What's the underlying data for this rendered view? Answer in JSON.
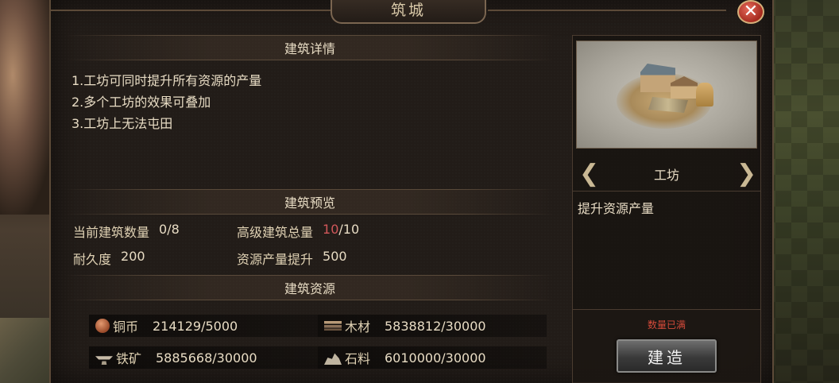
{
  "window": {
    "title": "筑城",
    "close_symbol": "✕"
  },
  "details": {
    "header": "建筑详情",
    "lines": [
      "1.工坊可同时提升所有资源的产量",
      "2.多个工坊的效果可叠加",
      "3.工坊上无法屯田"
    ]
  },
  "preview_stats": {
    "header": "建筑预览",
    "current_count_label": "当前建筑数量",
    "current_count_value": "0/8",
    "advanced_total_label": "高级建筑总量",
    "advanced_total_current": "10",
    "advanced_total_max": "/10",
    "durability_label": "耐久度",
    "durability_value": "200",
    "resource_boost_label": "资源产量提升",
    "resource_boost_value": "500"
  },
  "resources": {
    "header": "建筑资源",
    "items": [
      {
        "icon": "copper-coin-icon",
        "name": "铜币",
        "amount": "214129/5000"
      },
      {
        "icon": "wood-icon",
        "name": "木材",
        "amount": "5838812/30000"
      },
      {
        "icon": "iron-ore-icon",
        "name": "铁矿",
        "amount": "5885668/30000"
      },
      {
        "icon": "stone-icon",
        "name": "石料",
        "amount": "6010000/30000"
      }
    ]
  },
  "building": {
    "name": "工坊",
    "description": "提升资源产量",
    "prev_arrow": "❮",
    "next_arrow": "❯",
    "status": "数量已满",
    "build_label": "建造"
  },
  "colors": {
    "highlight_red": "#d1575a",
    "status_red": "#d44a3a",
    "panel_bg": "#221c18"
  }
}
